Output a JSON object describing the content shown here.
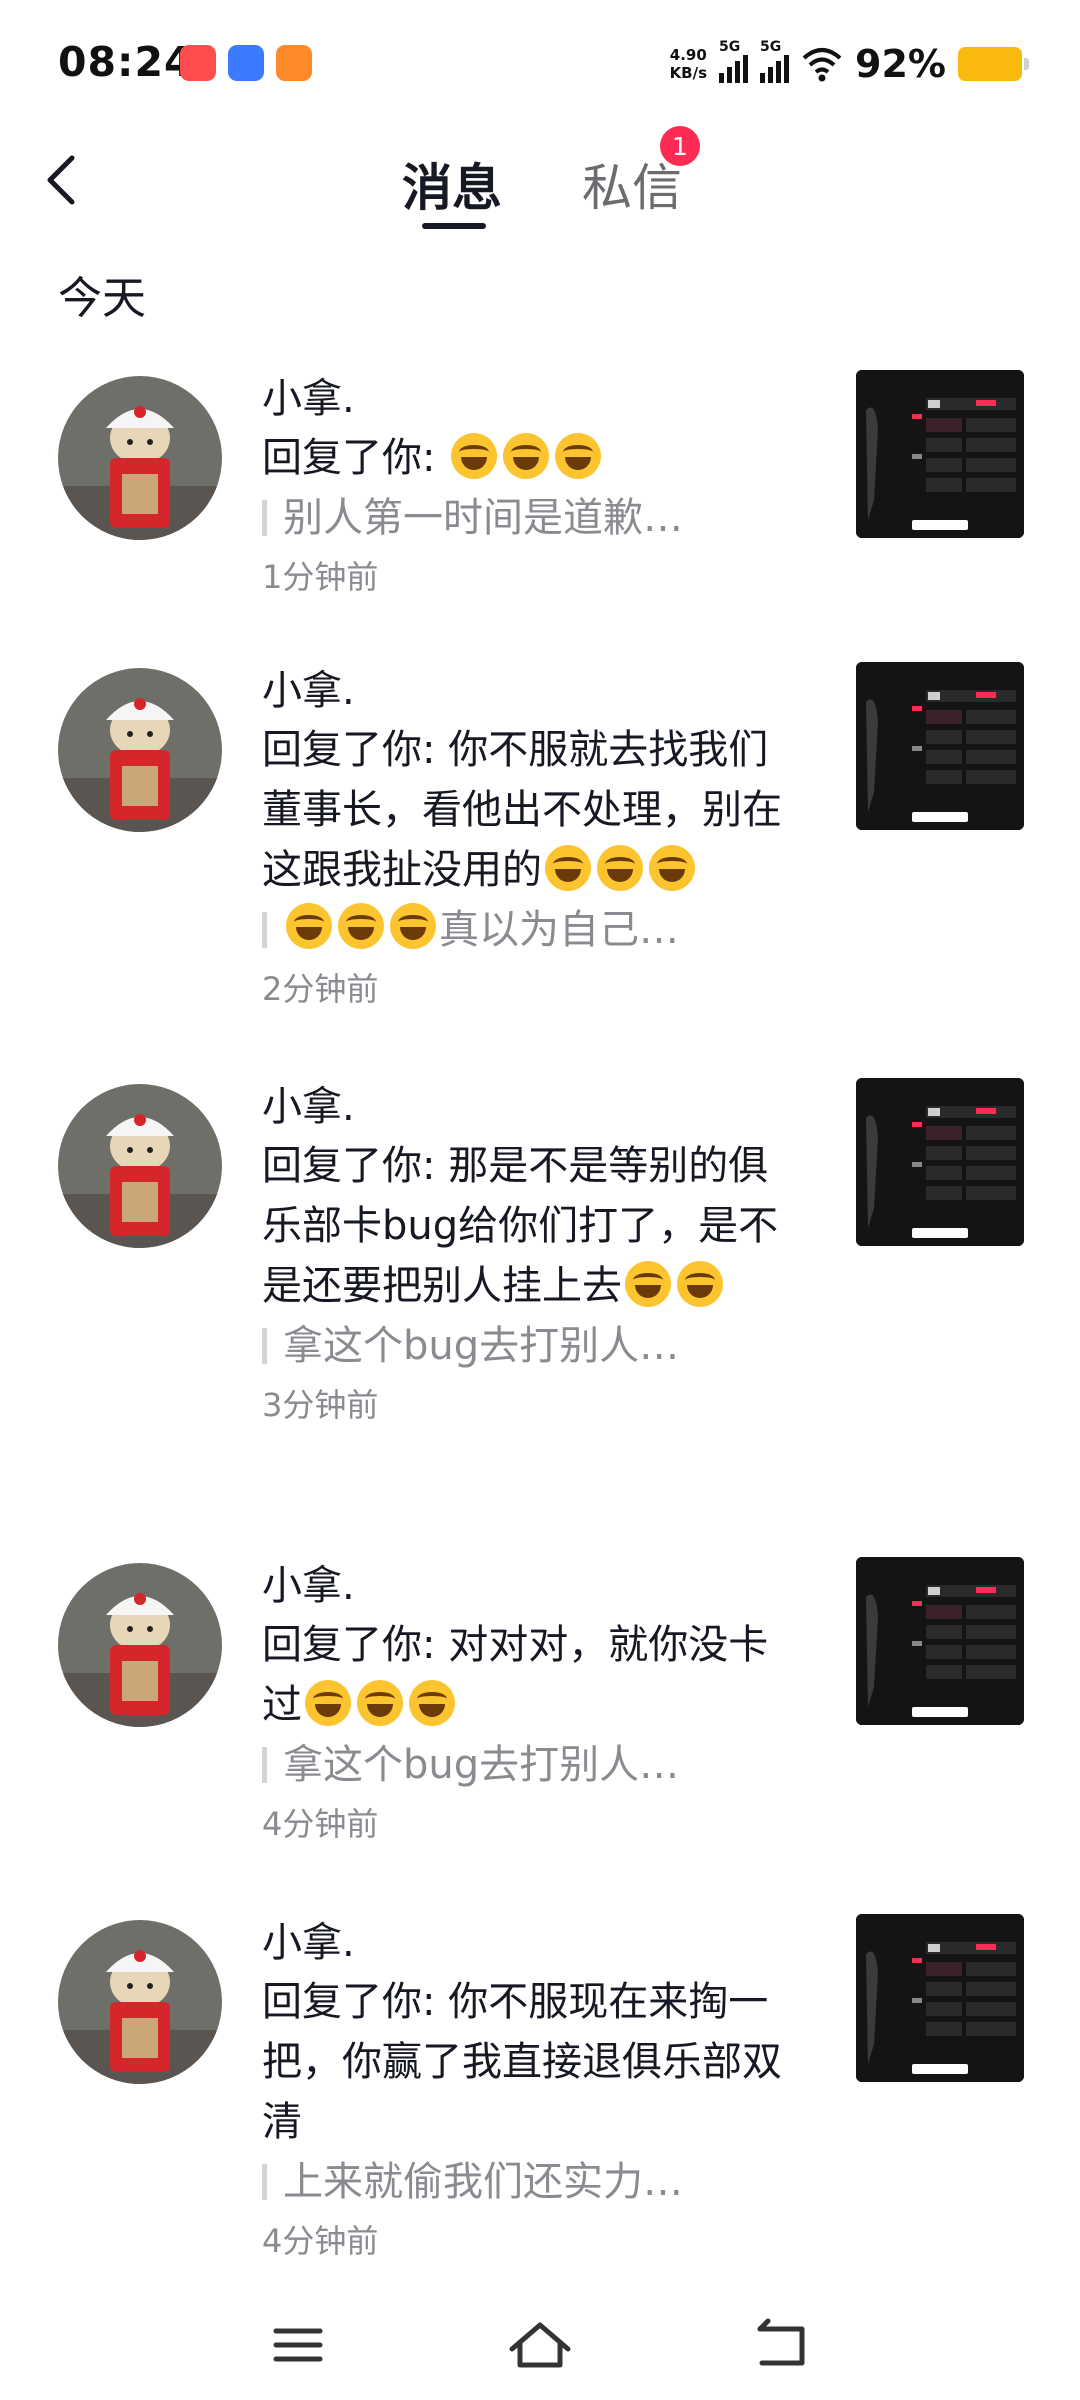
{
  "status_bar": {
    "time": "08:24",
    "net_speed_value": "4.90",
    "net_speed_unit": "KB/s",
    "signal_1_label": "5G",
    "signal_2_label": "5G",
    "battery_percent": "92%",
    "battery_color": "#f9b90f"
  },
  "header": {
    "back_icon": "chevron-left-icon",
    "tabs": [
      {
        "label": "消息",
        "active": true
      },
      {
        "label": "私信",
        "active": false
      }
    ],
    "dm_badge_count": "1"
  },
  "section_label": "今天",
  "notifications": [
    {
      "name": "小拿.",
      "reply": "回复了你: ",
      "reply_emoji_count": 3,
      "quote": "别人第一时间是道歉…",
      "quote_emoji_count": 0,
      "time": "1分钟前"
    },
    {
      "name": "小拿.",
      "reply": "回复了你: 你不服就去找我们董事长，看他出不处理，别在这跟我扯没用的",
      "reply_emoji_count": 3,
      "quote": "真以为自己…",
      "quote_emoji_count": 3,
      "time": "2分钟前"
    },
    {
      "name": "小拿.",
      "reply": "回复了你: 那是不是等别的俱乐部卡bug给你们打了，是不是还要把别人挂上去",
      "reply_emoji_count": 2,
      "quote": "拿这个bug去打别人…",
      "quote_emoji_count": 0,
      "time": "3分钟前"
    },
    {
      "name": "小拿.",
      "reply": "回复了你: 对对对，就你没卡过",
      "reply_emoji_count": 3,
      "quote": "拿这个bug去打别人…",
      "quote_emoji_count": 0,
      "time": "4分钟前"
    },
    {
      "name": "小拿.",
      "reply": "回复了你: 你不服现在来掏一把，你赢了我直接退俱乐部双清",
      "reply_emoji_count": 0,
      "quote": "上来就偷我们还实力…",
      "quote_emoji_count": 0,
      "time": "4分钟前"
    }
  ],
  "nav_bar": {
    "menu_icon": "menu-icon",
    "home_icon": "home-icon",
    "back_icon": "back-icon"
  },
  "colors": {
    "accent_red": "#fe2c55",
    "text_primary": "#161823",
    "text_secondary": "#8a8b91"
  }
}
